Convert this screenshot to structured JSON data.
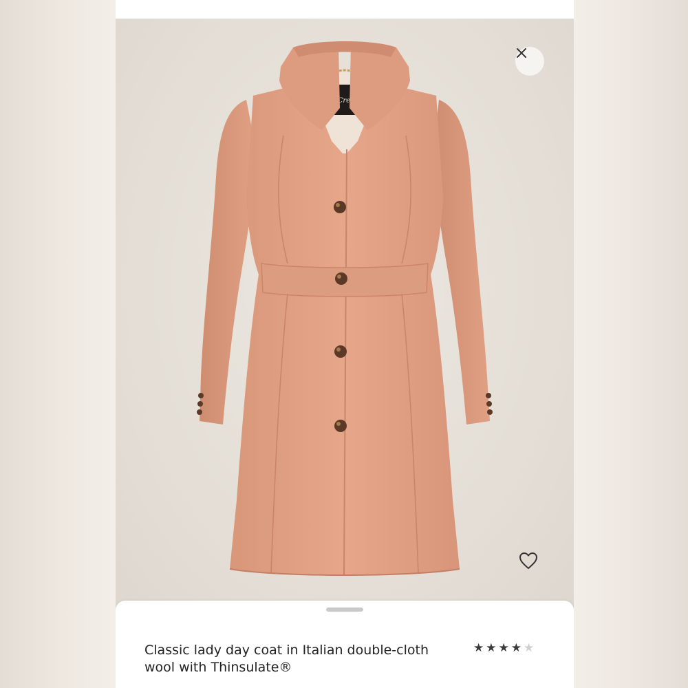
{
  "product": {
    "title": "Classic lady day coat in Italian double-cloth wool with Thinsulate®",
    "rating": {
      "value": 4,
      "max": 5
    },
    "label_brand": "J.Crew",
    "color": "#e2a287"
  },
  "actions": {
    "close_icon": "close-icon",
    "favorite_icon": "heart-outline-icon"
  },
  "colors": {
    "photo_background": "#e5e0d8",
    "star_filled": "#3a3a3a",
    "star_empty": "#cfcfcf"
  }
}
